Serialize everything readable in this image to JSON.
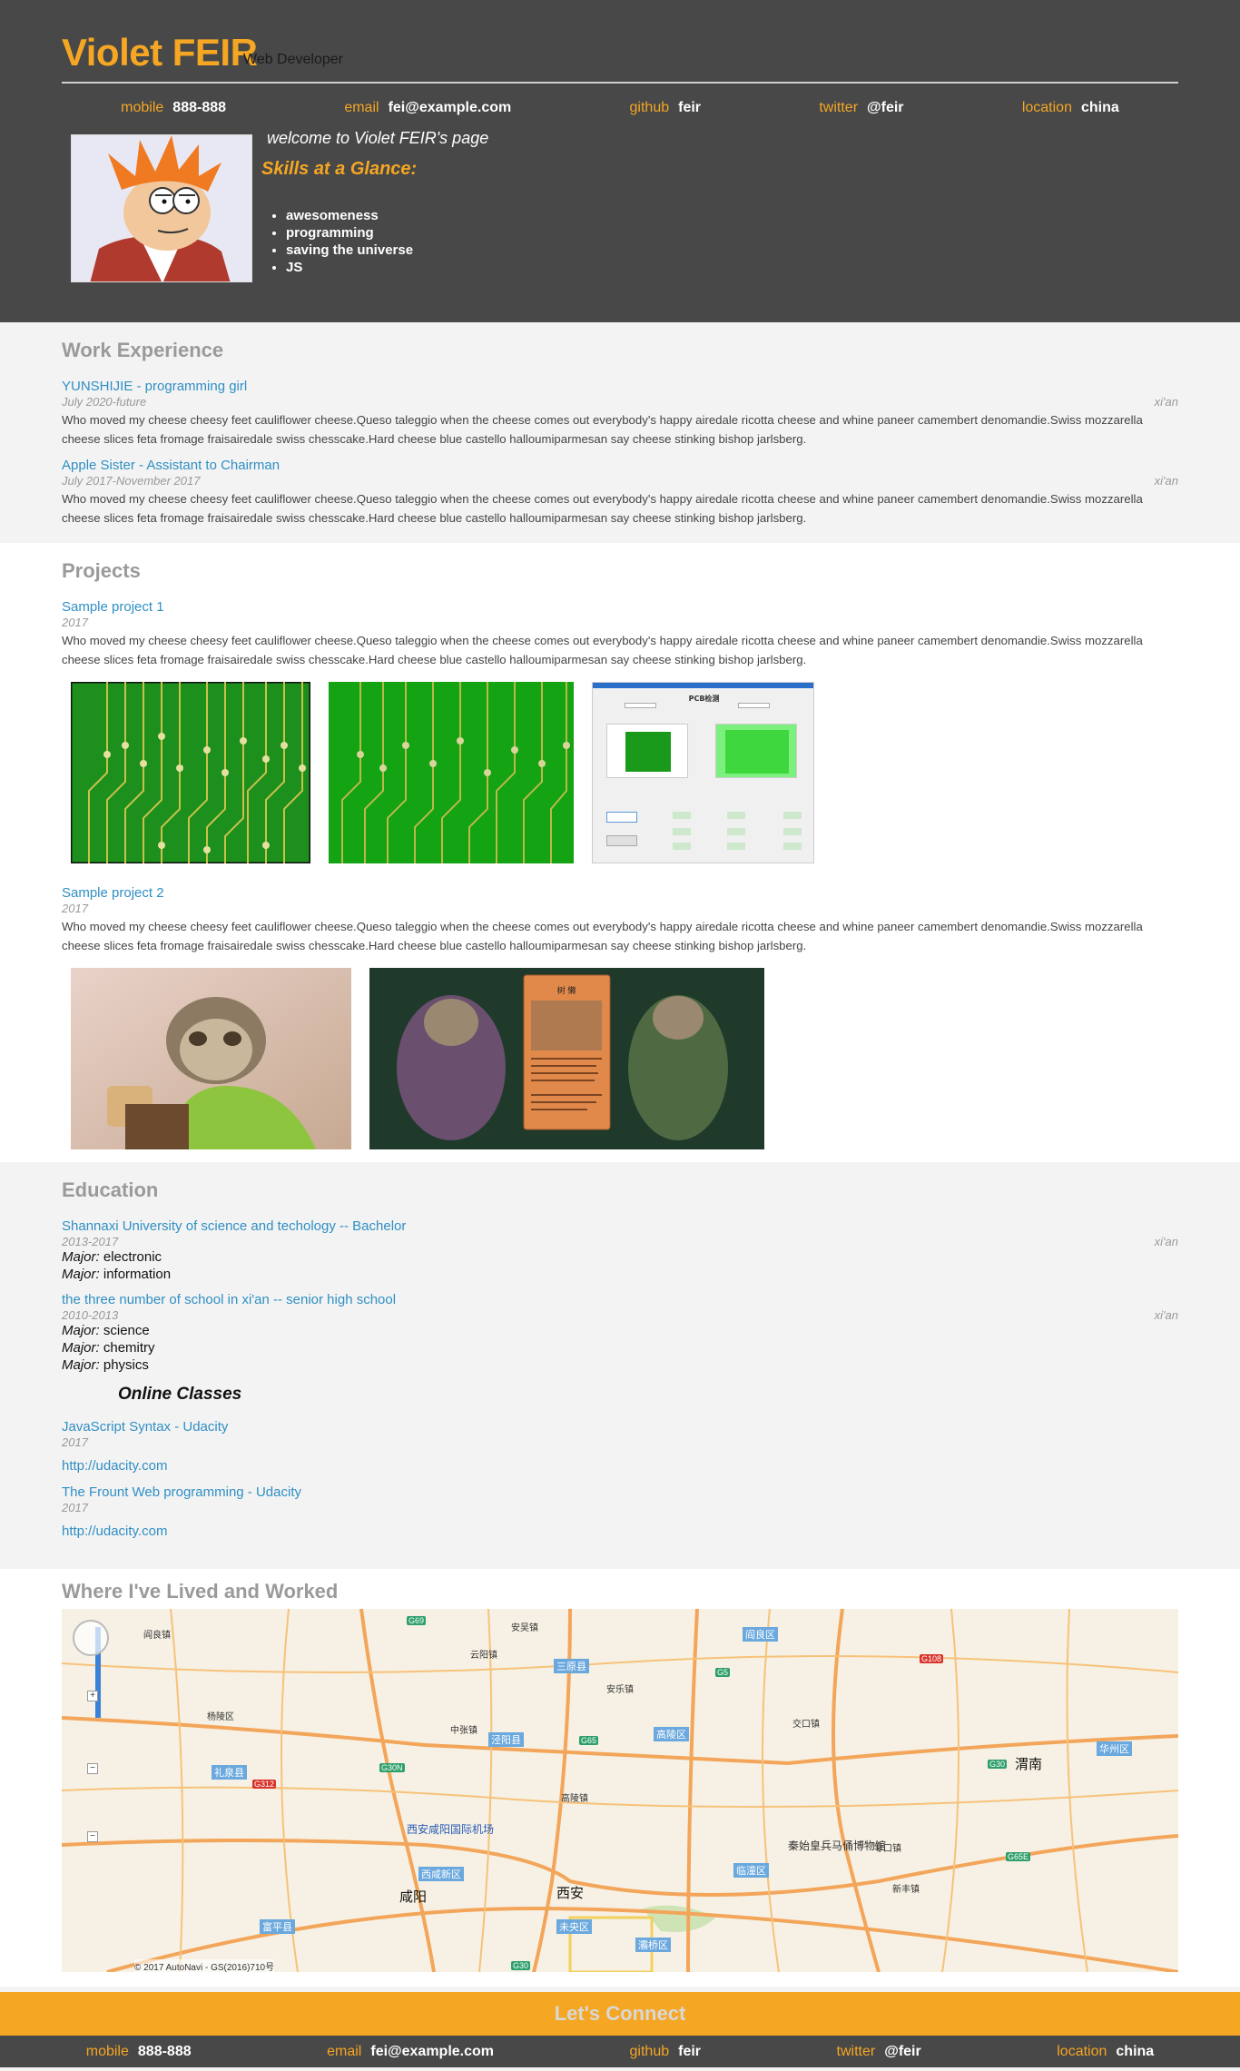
{
  "header": {
    "name": "Violet FEIR",
    "role": "Web Developer",
    "welcome": "welcome to Violet FEIR's page",
    "skills_title": "Skills at a Glance:",
    "skills": [
      "awesomeness",
      "programming",
      "saving the universe",
      "JS"
    ]
  },
  "contacts": [
    {
      "key": "mobile",
      "value": "888-888"
    },
    {
      "key": "email",
      "value": "fei@example.com"
    },
    {
      "key": "github",
      "value": "feir"
    },
    {
      "key": "twitter",
      "value": "@feir"
    },
    {
      "key": "location",
      "value": "china"
    }
  ],
  "work": {
    "title": "Work Experience",
    "jobs": [
      {
        "title": "YUNSHIJIE - programming girl",
        "dates": "July 2020-future",
        "location": "xi'an",
        "description": "Who moved my cheese cheesy feet cauliflower cheese.Queso taleggio when the cheese comes out everybody's happy airedale ricotta cheese and whine paneer camembert denomandie.Swiss mozzarella cheese slices feta fromage fraisairedale swiss chesscake.Hard cheese blue castello halloumiparmesan say cheese stinking bishop jarlsberg."
      },
      {
        "title": "Apple Sister - Assistant to Chairman",
        "dates": "July 2017-November 2017",
        "location": "xi'an",
        "description": "Who moved my cheese cheesy feet cauliflower cheese.Queso taleggio when the cheese comes out everybody's happy airedale ricotta cheese and whine paneer camembert denomandie.Swiss mozzarella cheese slices feta fromage fraisairedale swiss chesscake.Hard cheese blue castello halloumiparmesan say cheese stinking bishop jarlsberg."
      }
    ]
  },
  "projects": {
    "title": "Projects",
    "items": [
      {
        "title": "Sample project 1",
        "dates": "2017",
        "description": "Who moved my cheese cheesy feet cauliflower cheese.Queso taleggio when the cheese comes out everybody's happy airedale ricotta cheese and whine paneer camembert denomandie.Swiss mozzarella cheese slices feta fromage fraisairedale swiss chesscake.Hard cheese blue castello halloumiparmesan say cheese stinking bishop jarlsberg.",
        "app_title": "PCB检测"
      },
      {
        "title": "Sample project 2",
        "dates": "2017",
        "description": "Who moved my cheese cheesy feet cauliflower cheese.Queso taleggio when the cheese comes out everybody's happy airedale ricotta cheese and whine paneer camembert denomandie.Swiss mozzarella cheese slices feta fromage fraisairedale swiss chesscake.Hard cheese blue castello halloumiparmesan say cheese stinking bishop jarlsberg.",
        "card_title": "树 懒"
      }
    ]
  },
  "education": {
    "title": "Education",
    "schools": [
      {
        "title": "Shannaxi University of science and techology -- Bachelor",
        "dates": "2013-2017",
        "location": "xi'an",
        "majors": [
          "electronic",
          "information"
        ]
      },
      {
        "title": "the three number of school in xi'an -- senior high school",
        "dates": "2010-2013",
        "location": "xi'an",
        "majors": [
          "science",
          "chemitry",
          "physics"
        ]
      }
    ],
    "major_label": "Major:",
    "online_title": "Online Classes",
    "online": [
      {
        "title": "JavaScript Syntax - Udacity",
        "dates": "2017",
        "url": "http://udacity.com"
      },
      {
        "title": "The Frount Web programming - Udacity",
        "dates": "2017",
        "url": "http://udacity.com"
      }
    ]
  },
  "map": {
    "title": "Where I've Lived and Worked",
    "copyright": "© 2017 AutoNavi - GS(2016)710号",
    "labels": {
      "xian": "西安",
      "airport": "西安咸阳国际机场",
      "xianyang": "咸阳",
      "weinan": "渭南",
      "lintong": "临潼区",
      "gaoling": "高陵区",
      "sanyuan": "三原县",
      "jingyang": "泾阳县",
      "liquan": "礼泉县",
      "yanliang": "阎良区",
      "huazhou": "华州区",
      "chanba": "灞桥区",
      "weiyang": "未央区",
      "xixian": "西咸新区",
      "museum": "秦始皇兵马俑博物馆",
      "fuping": "富平县",
      "town1": "云阳镇",
      "town2": "安吴镇",
      "town3": "中张镇",
      "town4": "杨陵区",
      "town5": "高陵镇",
      "town6": "交口镇",
      "town7": "零口镇",
      "town8": "阎良镇",
      "town9": "安乐镇",
      "town10": "新丰镇"
    }
  },
  "connect": "Let's Connect"
}
